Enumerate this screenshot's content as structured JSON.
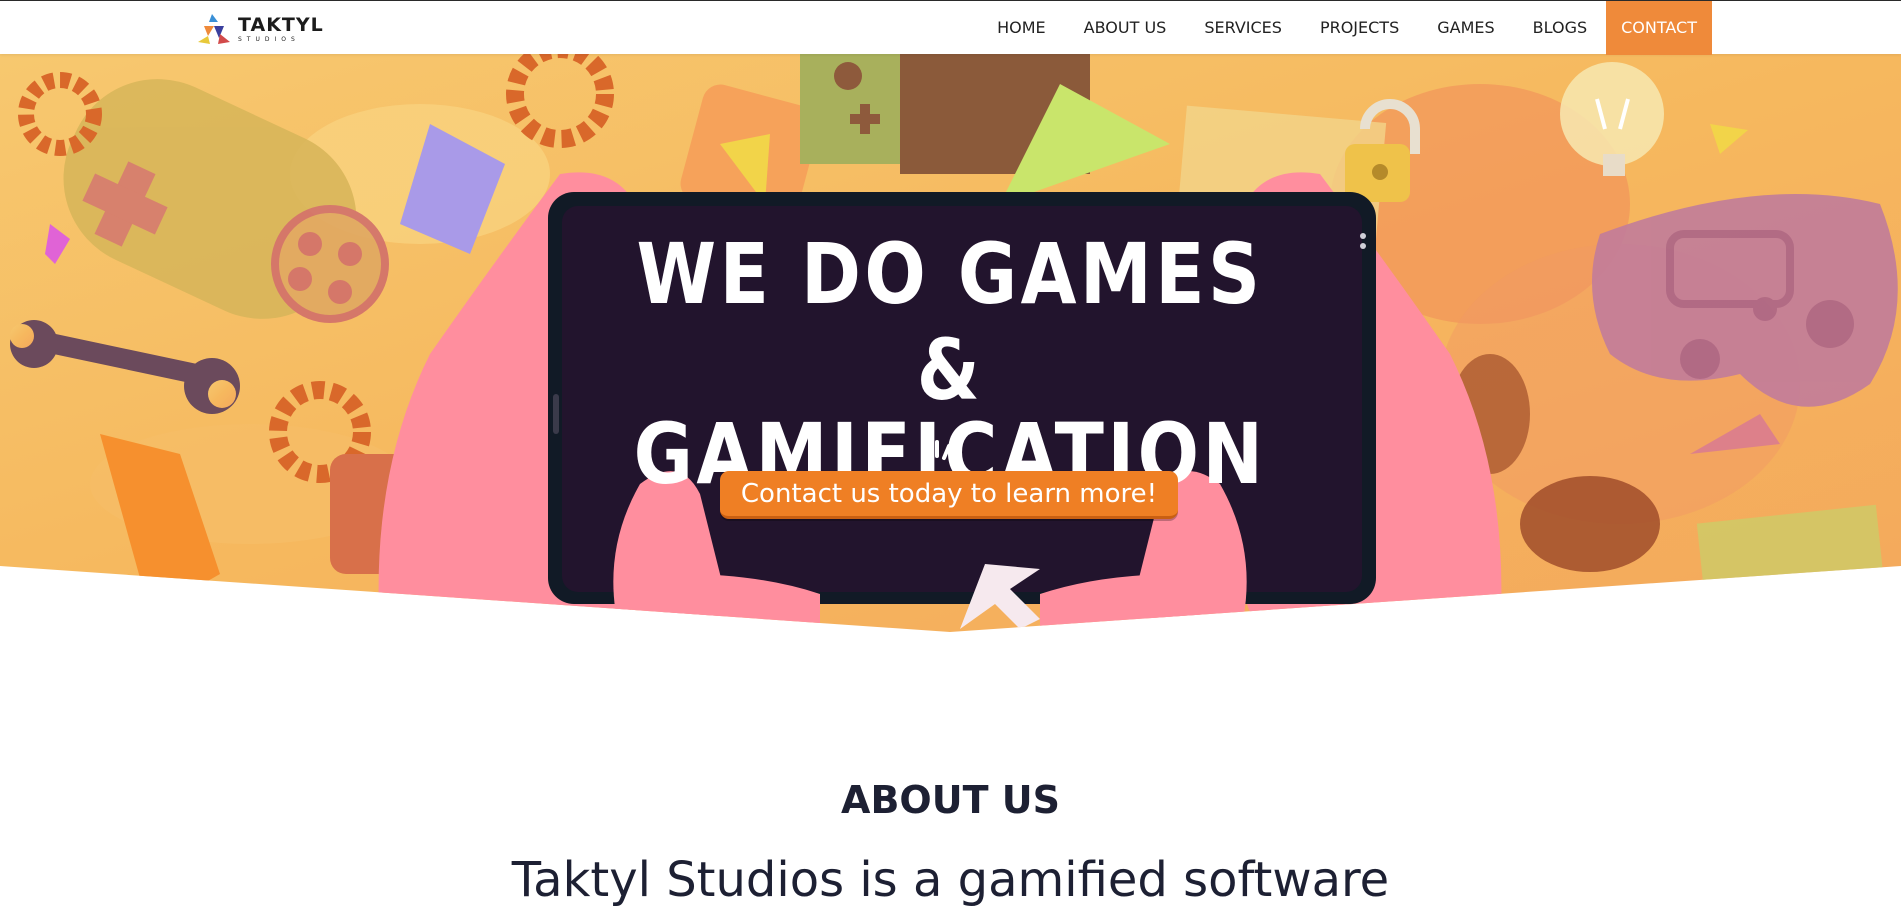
{
  "brand": {
    "name": "TAKTYL",
    "subtitle": "STUDIOS"
  },
  "nav": {
    "items": [
      {
        "label": "HOME"
      },
      {
        "label": "ABOUT US"
      },
      {
        "label": "SERVICES"
      },
      {
        "label": "PROJECTS"
      },
      {
        "label": "GAMES"
      },
      {
        "label": "BLOGS"
      },
      {
        "label": "CONTACT",
        "active": true
      }
    ]
  },
  "hero": {
    "line1": "WE DO GAMES",
    "line2": "& GAMIFICATION",
    "cta_label": "Contact us today to learn more!"
  },
  "about": {
    "heading": "ABOUT US",
    "intro": "Taktyl Studios is a gamified software"
  },
  "colors": {
    "accent": "#ef8a3a",
    "hero_bg": "#f6c46a",
    "phone_screen": "#22142d",
    "hands": "#ff8a9a",
    "heading": "#1d2033"
  }
}
